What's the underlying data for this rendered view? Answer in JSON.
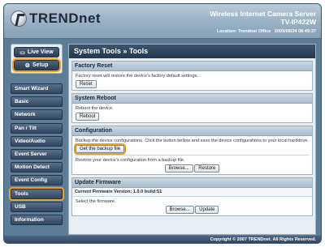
{
  "header": {
    "brand": "TRENDnet",
    "product_name": "Wireless Internet Camera Server",
    "model": "TV-IP422W",
    "location_label": "Location: Trendnet Office",
    "datetime": "2009/08/24 08:49:37"
  },
  "sidebar": {
    "top_buttons": [
      {
        "label": "Live View",
        "icon": "monitor-icon"
      },
      {
        "label": "Setup",
        "icon": "gear-icon"
      }
    ],
    "items": [
      {
        "label": "Smart Wizard"
      },
      {
        "label": "Basic"
      },
      {
        "label": "Network"
      },
      {
        "label": "Pan / Tilt"
      },
      {
        "label": "Video/Audio"
      },
      {
        "label": "Event Server"
      },
      {
        "label": "Motion Detect"
      },
      {
        "label": "Event Config"
      },
      {
        "label": "Tools"
      },
      {
        "label": "USB"
      },
      {
        "label": "Information"
      }
    ]
  },
  "main": {
    "title": "System Tools » Tools",
    "factory_reset": {
      "title": "Factory Reset",
      "description": "Factory reset will restore the device's factory default settings.",
      "button": "Reset"
    },
    "system_reboot": {
      "title": "System Reboot",
      "description": "Reboot the device.",
      "button": "Reboot"
    },
    "configuration": {
      "title": "Configuration",
      "description": "Backup the device configurations. Click the button bellow and save the device configurations to your local harddrive.",
      "backup_button": "Get the backup file",
      "restore_description": "Restore your device's configuration from a backup file.",
      "browse_button": "Browse...",
      "restore_button": "Restore"
    },
    "update_firmware": {
      "title": "Update Firmware",
      "current_version": "Current Firmware Version: 1.0.0 build:51",
      "description": "Select the firmware.",
      "browse_button": "Browse...",
      "update_button": "Update"
    }
  },
  "footer": {
    "copyright": "Copyright © 2007 TRENDnet. All Rights Reserved."
  },
  "colors": {
    "accent_highlight": "#f0a020",
    "frame_blue": "#5d7d97",
    "nav_dark": "#324862"
  }
}
